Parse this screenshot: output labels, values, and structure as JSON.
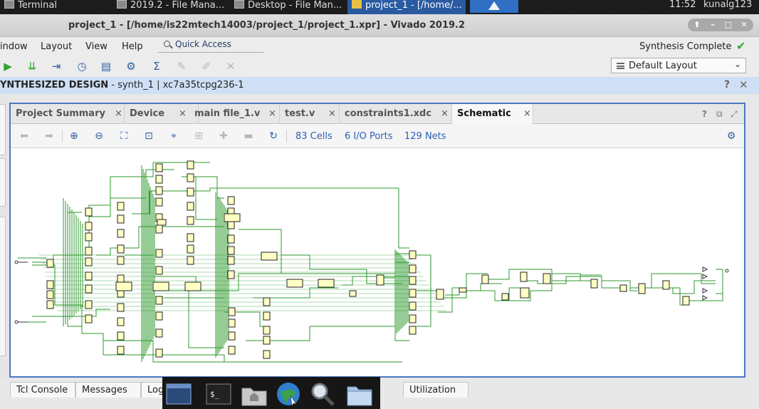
{
  "os_taskbar": {
    "tasks": [
      {
        "label": "Terminal"
      },
      {
        "label": "2019.2 - File Mana..."
      },
      {
        "label": "Desktop - File Man..."
      },
      {
        "label": "project_1 - [/home/..."
      }
    ],
    "clock": "11:52",
    "user": "kunalg123"
  },
  "window": {
    "title": "project_1 - [/home/is22mtech14003/project_1/project_1.xpr] - Vivado 2019.2",
    "controls": {
      "up": "⬆",
      "min": "–",
      "max": "□",
      "close": "✕"
    }
  },
  "menu": {
    "items": [
      {
        "label": "indow"
      },
      {
        "label": "Layout"
      },
      {
        "label": "View"
      },
      {
        "label": "Help"
      }
    ],
    "quick_access": "Quick Access",
    "status": "Synthesis Complete"
  },
  "toolbar": {
    "icons": [
      "run-icon",
      "download-icon",
      "step-icon",
      "timer-icon",
      "report-icon",
      "settings-icon",
      "sigma-icon",
      "disabled-tool-icon",
      "disabled-pencil-icon",
      "disabled-cross-icon"
    ],
    "layout_select": "Default Layout"
  },
  "design": {
    "header_bold": "YNTHESIZED DESIGN",
    "header_rest": " - synth_1 | xc7a35tcpg236-1"
  },
  "panel": {
    "tabs": [
      {
        "label": "Project Summary"
      },
      {
        "label": "Device"
      },
      {
        "label": "main file_1.v"
      },
      {
        "label": "test.v"
      },
      {
        "label": "constraints1.xdc"
      },
      {
        "label": "Schematic"
      }
    ],
    "close_glyph": "×",
    "stats": {
      "cells": "83 Cells",
      "ports": "6 I/O Ports",
      "nets": "129 Nets"
    }
  },
  "bottom_tabs": [
    {
      "label": "Tcl Console"
    },
    {
      "label": "Messages"
    },
    {
      "label": "Log"
    },
    {
      "label": "Utilization"
    }
  ],
  "colors": {
    "accent": "#2c62b4",
    "panel_border": "#4a78c0",
    "wire": "#2c9a2c",
    "cell_fill": "#ffffc4",
    "check": "#3aa536",
    "header_bg": "#cfe0f6"
  }
}
